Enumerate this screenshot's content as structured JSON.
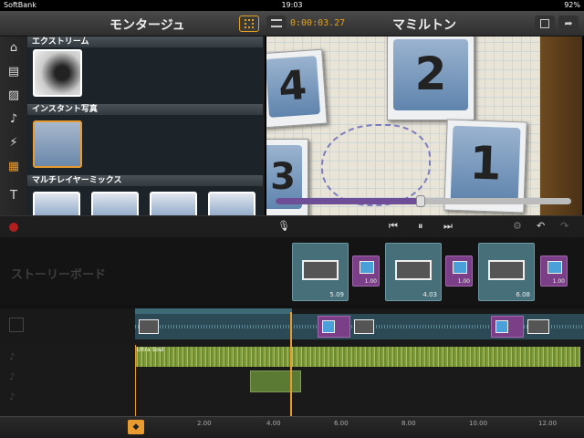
{
  "status": {
    "carrier": "SoftBank",
    "time": "19:03",
    "battery": "92%"
  },
  "header": {
    "left_title": "モンタージュ",
    "timecode": "0:00:03.27",
    "right_title": "マミルトン"
  },
  "sidebar": [
    {
      "name": "home-icon",
      "glyph": "⌂"
    },
    {
      "name": "clip-icon",
      "glyph": "▤"
    },
    {
      "name": "photo-icon",
      "glyph": "▨"
    },
    {
      "name": "music-icon",
      "glyph": "♪"
    },
    {
      "name": "transition-icon",
      "glyph": "⚡"
    },
    {
      "name": "theme-icon",
      "glyph": "▦"
    },
    {
      "name": "title-icon",
      "glyph": "T"
    }
  ],
  "library": {
    "sections": [
      {
        "label": "エクストリーム"
      },
      {
        "label": "インスタント写真"
      },
      {
        "label": "マルチレイヤーミックス"
      }
    ]
  },
  "preview": {
    "cards": [
      "4",
      "2",
      "1",
      "3"
    ],
    "progress": 0.49
  },
  "storyboard": {
    "label": "ストーリーボード",
    "items": [
      {
        "type": "clip",
        "duration": "5.09"
      },
      {
        "type": "transition",
        "duration": "1.00"
      },
      {
        "type": "clip",
        "duration": "4.03"
      },
      {
        "type": "transition",
        "duration": "1.00"
      },
      {
        "type": "clip",
        "duration": "6.08"
      },
      {
        "type": "transition",
        "duration": "1.00"
      }
    ]
  },
  "timeline": {
    "audio_label": "Ultra Soul",
    "ruler": [
      "2.00",
      "4.00",
      "6.00",
      "8.00",
      "10.00",
      "12.00"
    ]
  },
  "colors": {
    "accent": "#e89b2f",
    "transition": "#7a3f86",
    "clip": "#466f7a"
  }
}
